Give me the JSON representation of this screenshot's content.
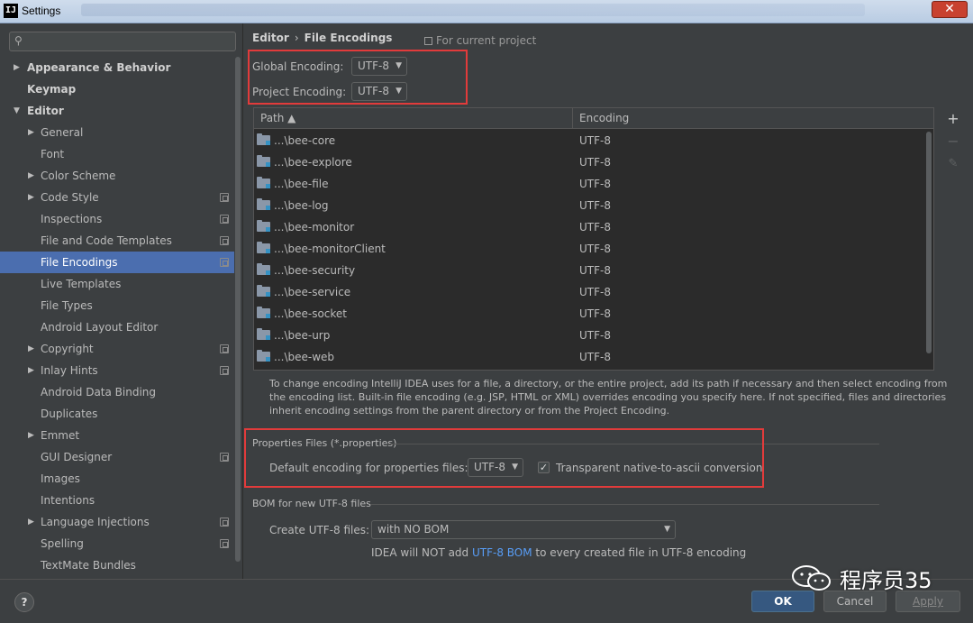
{
  "window": {
    "title": "Settings",
    "app_icon": "IJ",
    "close_glyph": "✕"
  },
  "search": {
    "placeholder": "",
    "icon": "search-icon"
  },
  "sidebar": {
    "items": [
      {
        "label": "Appearance & Behavior",
        "level": 0,
        "bold": true,
        "arrow": "▶",
        "project_icon": false,
        "selected": false
      },
      {
        "label": "Keymap",
        "level": 0,
        "bold": true,
        "arrow": "",
        "project_icon": false,
        "selected": false
      },
      {
        "label": "Editor",
        "level": 0,
        "bold": true,
        "arrow": "▼",
        "project_icon": false,
        "selected": false
      },
      {
        "label": "General",
        "level": 1,
        "bold": false,
        "arrow": "▶",
        "project_icon": false,
        "selected": false
      },
      {
        "label": "Font",
        "level": 1,
        "bold": false,
        "arrow": "",
        "project_icon": false,
        "selected": false
      },
      {
        "label": "Color Scheme",
        "level": 1,
        "bold": false,
        "arrow": "▶",
        "project_icon": false,
        "selected": false
      },
      {
        "label": "Code Style",
        "level": 1,
        "bold": false,
        "arrow": "▶",
        "project_icon": true,
        "selected": false
      },
      {
        "label": "Inspections",
        "level": 1,
        "bold": false,
        "arrow": "",
        "project_icon": true,
        "selected": false
      },
      {
        "label": "File and Code Templates",
        "level": 1,
        "bold": false,
        "arrow": "",
        "project_icon": true,
        "selected": false
      },
      {
        "label": "File Encodings",
        "level": 1,
        "bold": false,
        "arrow": "",
        "project_icon": true,
        "selected": true
      },
      {
        "label": "Live Templates",
        "level": 1,
        "bold": false,
        "arrow": "",
        "project_icon": false,
        "selected": false
      },
      {
        "label": "File Types",
        "level": 1,
        "bold": false,
        "arrow": "",
        "project_icon": false,
        "selected": false
      },
      {
        "label": "Android Layout Editor",
        "level": 1,
        "bold": false,
        "arrow": "",
        "project_icon": false,
        "selected": false
      },
      {
        "label": "Copyright",
        "level": 1,
        "bold": false,
        "arrow": "▶",
        "project_icon": true,
        "selected": false
      },
      {
        "label": "Inlay Hints",
        "level": 1,
        "bold": false,
        "arrow": "▶",
        "project_icon": true,
        "selected": false
      },
      {
        "label": "Android Data Binding",
        "level": 1,
        "bold": false,
        "arrow": "",
        "project_icon": false,
        "selected": false
      },
      {
        "label": "Duplicates",
        "level": 1,
        "bold": false,
        "arrow": "",
        "project_icon": false,
        "selected": false
      },
      {
        "label": "Emmet",
        "level": 1,
        "bold": false,
        "arrow": "▶",
        "project_icon": false,
        "selected": false
      },
      {
        "label": "GUI Designer",
        "level": 1,
        "bold": false,
        "arrow": "",
        "project_icon": true,
        "selected": false
      },
      {
        "label": "Images",
        "level": 1,
        "bold": false,
        "arrow": "",
        "project_icon": false,
        "selected": false
      },
      {
        "label": "Intentions",
        "level": 1,
        "bold": false,
        "arrow": "",
        "project_icon": false,
        "selected": false
      },
      {
        "label": "Language Injections",
        "level": 1,
        "bold": false,
        "arrow": "▶",
        "project_icon": true,
        "selected": false
      },
      {
        "label": "Spelling",
        "level": 1,
        "bold": false,
        "arrow": "",
        "project_icon": true,
        "selected": false
      },
      {
        "label": "TextMate Bundles",
        "level": 1,
        "bold": false,
        "arrow": "",
        "project_icon": false,
        "selected": false
      }
    ]
  },
  "main": {
    "breadcrumb": {
      "parent": "Editor",
      "separator": "›",
      "current": "File Encodings"
    },
    "scope_note": "For current project",
    "global_encoding": {
      "label": "Global Encoding:",
      "value": "UTF-8"
    },
    "project_encoding": {
      "label": "Project Encoding:",
      "value": "UTF-8"
    },
    "table": {
      "columns": {
        "path": "Path ▲",
        "encoding": "Encoding"
      },
      "rows": [
        {
          "path": "...\\bee-core",
          "encoding": "UTF-8"
        },
        {
          "path": "...\\bee-explore",
          "encoding": "UTF-8"
        },
        {
          "path": "...\\bee-file",
          "encoding": "UTF-8"
        },
        {
          "path": "...\\bee-log",
          "encoding": "UTF-8"
        },
        {
          "path": "...\\bee-monitor",
          "encoding": "UTF-8"
        },
        {
          "path": "...\\bee-monitorClient",
          "encoding": "UTF-8"
        },
        {
          "path": "...\\bee-security",
          "encoding": "UTF-8"
        },
        {
          "path": "...\\bee-service",
          "encoding": "UTF-8"
        },
        {
          "path": "...\\bee-socket",
          "encoding": "UTF-8"
        },
        {
          "path": "...\\bee-urp",
          "encoding": "UTF-8"
        },
        {
          "path": "...\\bee-web",
          "encoding": "UTF-8"
        }
      ],
      "tools": {
        "add": "+",
        "remove": "−",
        "edit": "✎"
      }
    },
    "help_text": "To change encoding IntelliJ IDEA uses for a file, a directory, or the entire project, add its path if necessary and then select encoding from the encoding list. Built-in file encoding (e.g. JSP, HTML or XML) overrides encoding you specify here. If not specified, files and directories inherit encoding settings from the parent directory or from the Project Encoding.",
    "properties": {
      "section_title": "Properties Files (*.properties)",
      "default_label": "Default encoding for properties files:",
      "default_value": "UTF-8",
      "native_ascii_label": "Transparent native-to-ascii conversion",
      "native_ascii_checked": true,
      "check_glyph": "✓"
    },
    "bom": {
      "section_title": "BOM for new UTF-8 files",
      "create_label": "Create UTF-8 files:",
      "create_value": "with NO BOM",
      "info_prefix": "IDEA will NOT add ",
      "info_link": "UTF-8 BOM",
      "info_suffix": " to every created file in UTF-8 encoding"
    },
    "combo_caret": "▼"
  },
  "footer": {
    "help": "?",
    "ok": "OK",
    "cancel": "Cancel",
    "apply": "Apply"
  },
  "watermark": {
    "text": "程序员35"
  },
  "colors": {
    "background": "#3c3f41",
    "selection": "#4b6eaf",
    "highlight_box": "#e23b3b",
    "link": "#589df6",
    "ok_button": "#365880"
  }
}
